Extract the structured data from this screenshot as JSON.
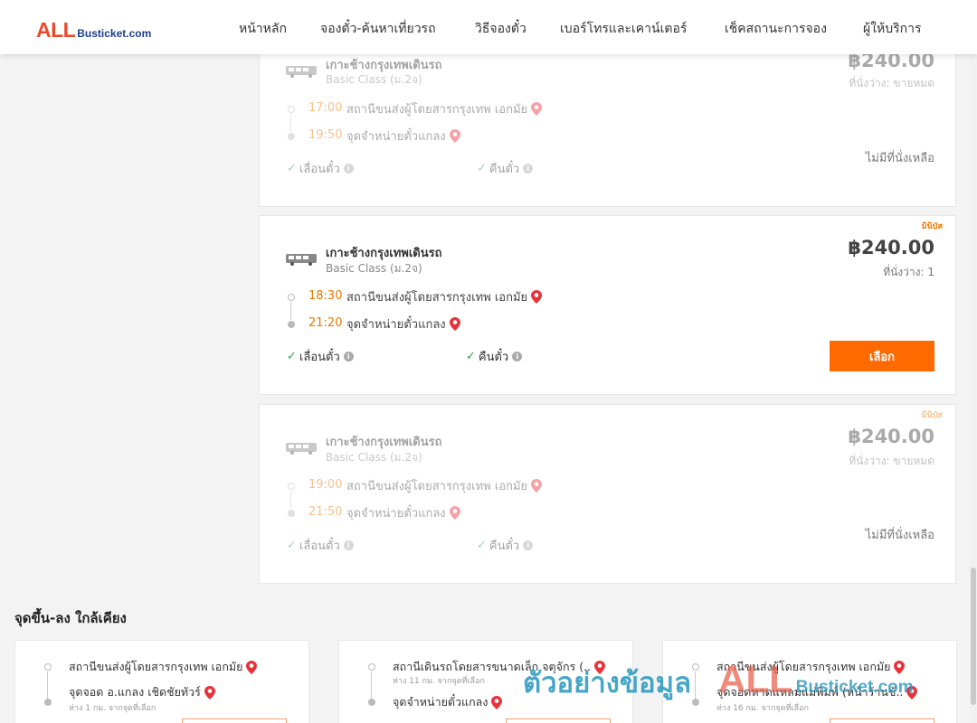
{
  "header": {
    "logo_all": "ALL",
    "logo_bus": "Busticket.com",
    "nav": [
      {
        "label": "หน้าหลัก"
      },
      {
        "label": "จองตั๋ว-ค้นหาเที่ยวรถ"
      },
      {
        "label": "วิธีจองตั๋ว"
      },
      {
        "label": "เบอร์โทรและเคาน์เตอร์"
      },
      {
        "label": "เช็คสถานะการจอง"
      },
      {
        "label": "ผู้ให้บริการ"
      }
    ]
  },
  "trips": [
    {
      "operator": "เกาะช้างกรุงเทพเดินรถ",
      "class": "Basic Class (ม.2จ)",
      "price": "฿240.00",
      "seats": "ที่นั่งว่าง: ขายหมด",
      "depart_time": "17:00",
      "depart_stop": "สถานีขนส่งผู้โดยสารกรุงเทพ เอกมัย",
      "arrive_time": "19:50",
      "arrive_stop": "จุดจำหน่ายตั๋วแกลง",
      "feature_1": "เลื่อนตั๋ว",
      "feature_2": "คืนตั๋ว",
      "status": "ไม่มีที่นั่งเหลือ"
    },
    {
      "badge": "มินิบัส",
      "operator": "เกาะช้างกรุงเทพเดินรถ",
      "class": "Basic Class (ม.2จ)",
      "price": "฿240.00",
      "seats": "ที่นั่งว่าง: 1",
      "depart_time": "18:30",
      "depart_stop": "สถานีขนส่งผู้โดยสารกรุงเทพ เอกมัย",
      "arrive_time": "21:20",
      "arrive_stop": "จุดจำหน่ายตั๋วแกลง",
      "feature_1": "เลื่อนตั๋ว",
      "feature_2": "คืนตั๋ว",
      "button": "เลือก"
    },
    {
      "badge": "มินิบัส",
      "operator": "เกาะช้างกรุงเทพเดินรถ",
      "class": "Basic Class (ม.2จ)",
      "price": "฿240.00",
      "seats": "ที่นั่งว่าง: ขายหมด",
      "depart_time": "19:00",
      "depart_stop": "สถานีขนส่งผู้โดยสารกรุงเทพ เอกมัย",
      "arrive_time": "21:50",
      "arrive_stop": "จุดจำหน่ายตั๋วแกลง",
      "feature_1": "เลื่อนตั๋ว",
      "feature_2": "คืนตั๋ว",
      "status": "ไม่มีที่นั่งเหลือ"
    }
  ],
  "nearby": {
    "title": "จุดขึ้น-ลง ใกล้เคียง",
    "cards": [
      {
        "from": "สถานีขนส่งผู้โดยสารกรุงเทพ เอกมัย",
        "from_dist": "",
        "to": "จุดจอด อ.แกลง เชิดชัยทัวร์",
        "to_dist": "ห่าง 1 กม. จากจุดที่เลือก"
      },
      {
        "from": "สถานีเดินรถโดยสารขนาดเล็ก จตุจักร (..",
        "from_dist": "ห่าง 11 กม. จากจุดที่เลือก",
        "to": "จุดจำหน่ายตั๋วแกลง",
        "to_dist": ""
      },
      {
        "from": "สถานีขนส่งผู้โดยสารกรุงเทพ เอกมัย",
        "from_dist": "",
        "to": "จุดจอดหาดแหลมแม่พิมพ์ (หน้าร้านข้..",
        "to_dist": "ห่าง 16 กม. จากจุดที่เลือก"
      }
    ]
  },
  "watermark": {
    "thai": "ตัวอย่างข้อมูล",
    "all": "ALL",
    "bus": "Busticket.com"
  },
  "colors": {
    "accent": "#ff6a00",
    "time": "#ee7700",
    "check": "#2aa44a",
    "pin": "#e8323a",
    "logo_red": "#ec4a2c",
    "logo_blue": "#1d3f8c"
  }
}
